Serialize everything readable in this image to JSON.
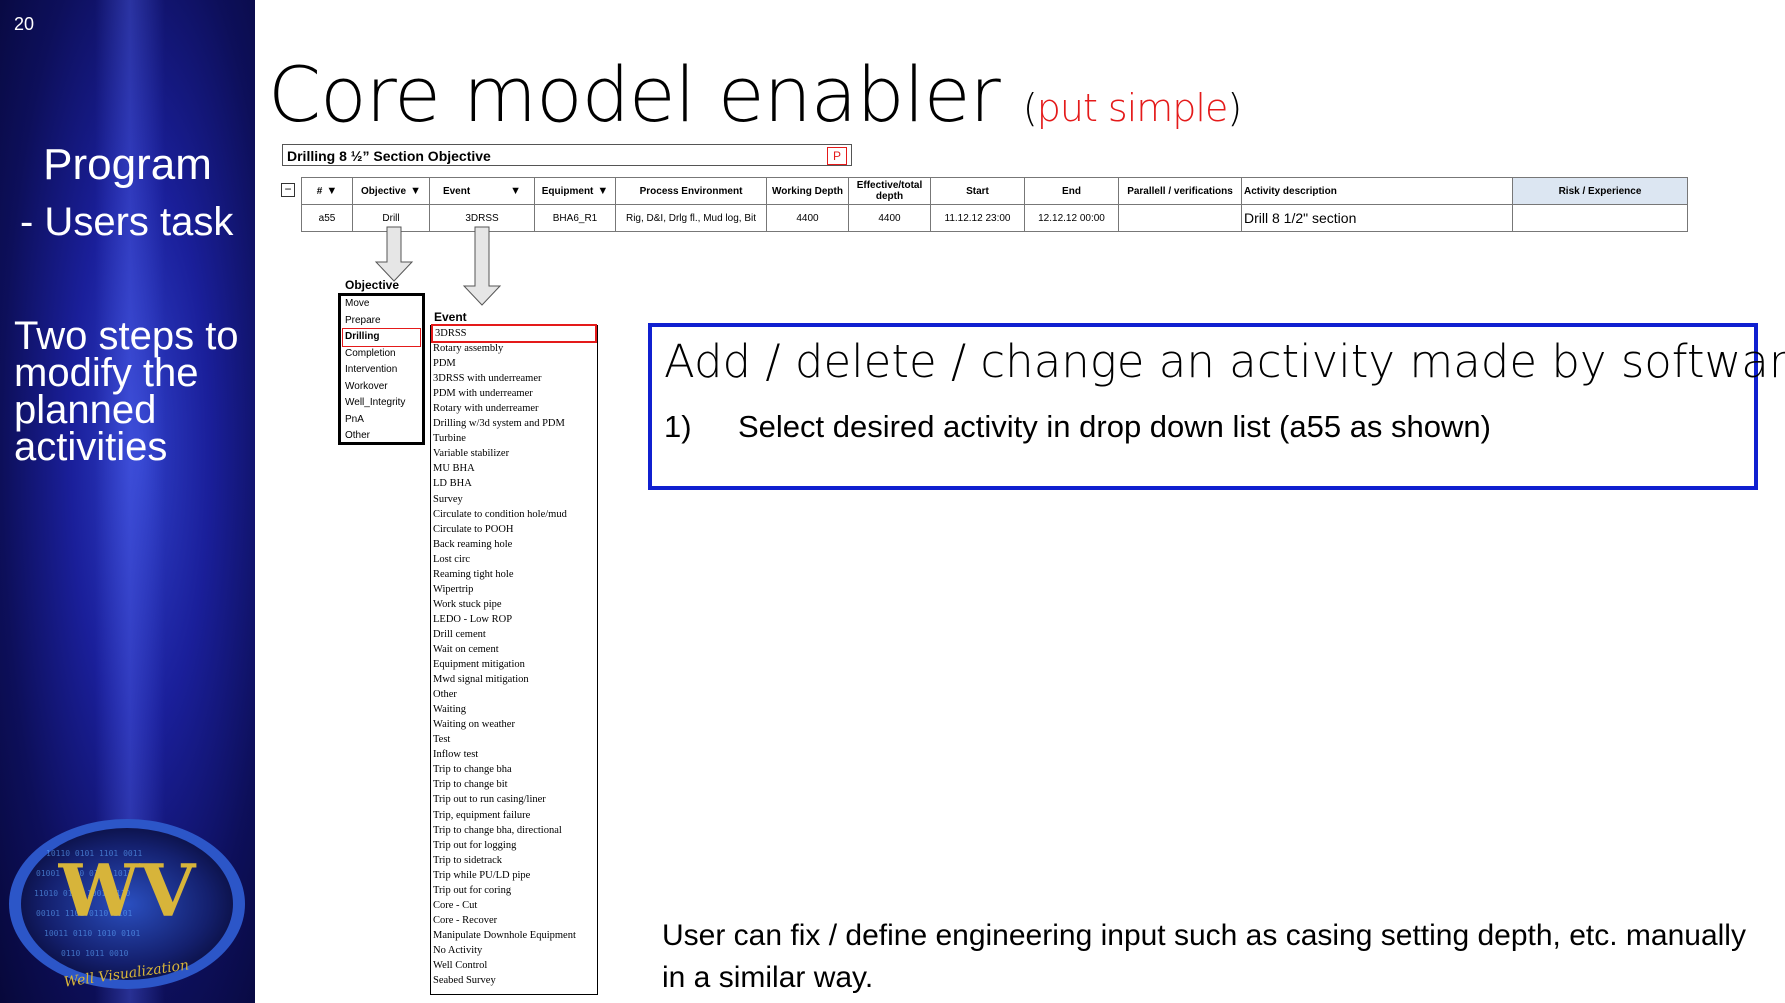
{
  "slide_number": "20",
  "sidebar": {
    "title": "Program",
    "subtitle": "-  Users task",
    "steps_note": "Two steps to modify the planned activities",
    "logo_letters": "WV",
    "logo_text": "Well Visualization"
  },
  "title": {
    "main": "Core model enabler",
    "paren_open": "(",
    "paren_red": "put simple",
    "paren_close": ")"
  },
  "section": {
    "label": "Drilling 8 ½” Section Objective",
    "badge": "P",
    "collapse": "−"
  },
  "table": {
    "headers": [
      "#",
      "Objective",
      "Event",
      "Equipment",
      "Process Environment",
      "Working Depth",
      "Effective/total depth",
      "Start",
      "End",
      "Parallell / verifications",
      "Activity description",
      "Risk / Experience"
    ],
    "row": [
      "a55",
      "Drill",
      "3DRSS",
      "BHA6_R1",
      "Rig, D&I, Drlg fl., Mud log, Bit",
      "4400",
      "4400",
      "11.12.12 23:00",
      "12.12.12 00:00",
      "",
      "Drill 8 1/2\" section",
      ""
    ]
  },
  "objective_dropdown": {
    "label": "Objective",
    "items": [
      "Move",
      "Prepare",
      "Drilling",
      "Completion",
      "Intervention",
      "Workover",
      "Well_Integrity",
      "PnA",
      "Other"
    ],
    "selected": "Drilling"
  },
  "event_dropdown": {
    "label": "Event",
    "items": [
      "3DRSS",
      "Rotary assembly",
      "PDM",
      "3DRSS with underreamer",
      "PDM with underreamer",
      "Rotary with underreamer",
      "Drilling w/3d system and PDM",
      "Turbine",
      "Variable stabilizer",
      "MU BHA",
      "LD BHA",
      "Survey",
      "Circulate to condition hole/mud",
      "Circulate to POOH",
      "Back reaming hole",
      "Lost circ",
      "Reaming tight hole",
      "Wipertrip",
      "Work stuck pipe",
      "LEDO - Low ROP",
      "Drill cement",
      "Wait on cement",
      "Equipment mitigation",
      "Mwd signal mitigation",
      "Other",
      "Waiting",
      "Waiting on weather",
      "Test",
      "Inflow test",
      "Trip to change bha",
      "Trip to change bit",
      "Trip out to run casing/liner",
      "Trip, equipment failure",
      "Trip to change bha, directional",
      "Trip out for logging",
      "Trip to sidetrack",
      "Trip while PU/LD pipe",
      "Trip out for coring",
      "Core - Cut",
      "Core - Recover",
      "Manipulate Downhole Equipment",
      "No Activity",
      "Well Control",
      "Seabed Survey"
    ],
    "selected": "3DRSS"
  },
  "info_box": {
    "title": "Add / delete / change an activity made by software:",
    "step_number": "1)",
    "step_text": "Select desired activity in drop down list (a55 as shown)"
  },
  "footer": "User can fix / define engineering input such as casing setting depth, etc. manually in a similar way."
}
